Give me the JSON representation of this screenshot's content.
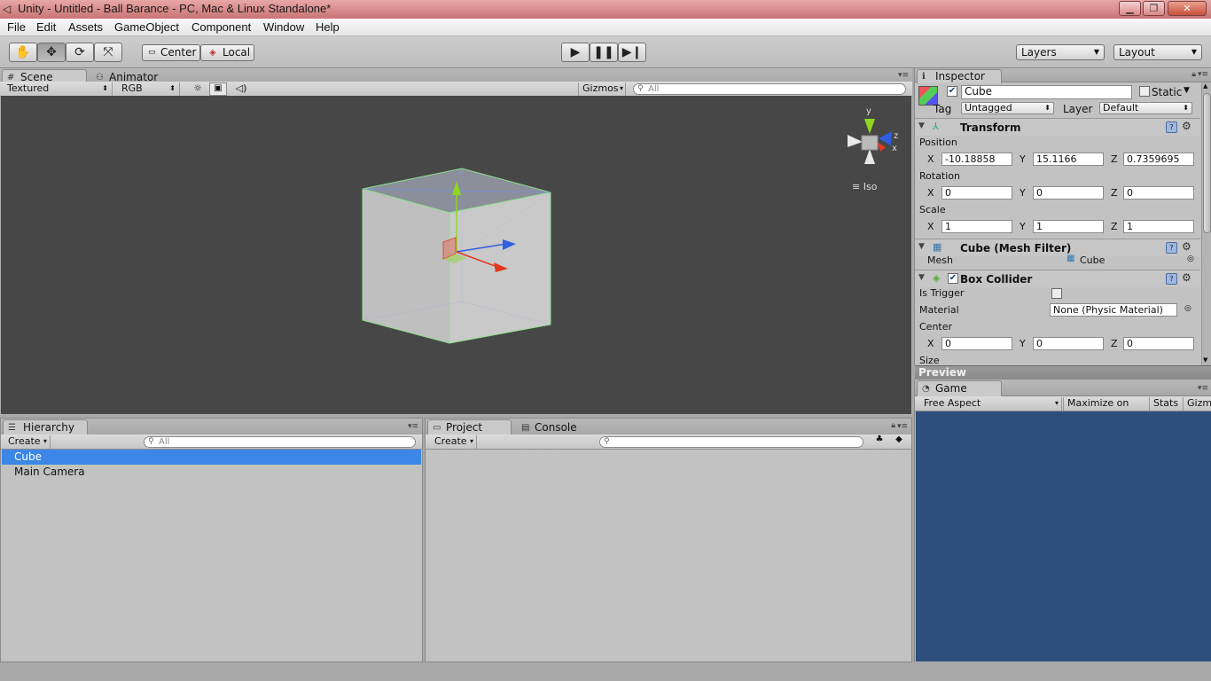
{
  "window": {
    "title": "Unity - Untitled - Ball Barance - PC, Mac & Linux Standalone*"
  },
  "menu": [
    "File",
    "Edit",
    "Assets",
    "GameObject",
    "Component",
    "Window",
    "Help"
  ],
  "toolbar": {
    "pivot": "Center",
    "space": "Local",
    "layers": "Layers",
    "layout": "Layout"
  },
  "scene": {
    "tab_scene": "Scene",
    "tab_animator": "Animator",
    "render_mode": "Textured",
    "color_mode": "RGB",
    "gizmos": "Gizmos",
    "search_placeholder": "All",
    "iso_label": "Iso",
    "gizmo_axes": {
      "y": "y",
      "z": "z",
      "x": "x"
    }
  },
  "hierarchy": {
    "tab": "Hierarchy",
    "create": "Create",
    "search_placeholder": "All",
    "items": [
      "Cube",
      "Main Camera"
    ],
    "selected_index": 0
  },
  "project": {
    "tab_project": "Project",
    "tab_console": "Console",
    "create": "Create"
  },
  "inspector": {
    "tab": "Inspector",
    "object_name": "Cube",
    "static_label": "Static",
    "tag_label": "Tag",
    "tag_value": "Untagged",
    "layer_label": "Layer",
    "layer_value": "Default",
    "transform": {
      "title": "Transform",
      "position_label": "Position",
      "rotation_label": "Rotation",
      "scale_label": "Scale",
      "axis_x": "X",
      "axis_y": "Y",
      "axis_z": "Z",
      "position": {
        "x": "-10.18858",
        "y": "15.1166",
        "z": "0.7359695"
      },
      "rotation": {
        "x": "0",
        "y": "0",
        "z": "0"
      },
      "scale": {
        "x": "1",
        "y": "1",
        "z": "1"
      }
    },
    "mesh_filter": {
      "title": "Cube (Mesh Filter)",
      "mesh_label": "Mesh",
      "mesh_value": "Cube"
    },
    "box_collider": {
      "title": "Box Collider",
      "is_trigger_label": "Is Trigger",
      "material_label": "Material",
      "material_value": "None (Physic Material)",
      "center_label": "Center",
      "center": {
        "x": "0",
        "y": "0",
        "z": "0"
      },
      "size_label": "Size"
    },
    "preview": "Preview"
  },
  "game": {
    "tab": "Game",
    "aspect": "Free Aspect",
    "maximize": "Maximize on Play",
    "stats": "Stats",
    "gizmos": "Gizmos",
    "background_color": "#2e4f7e"
  },
  "colors": {
    "selection": "#3b86e6",
    "viewport": "#474747",
    "axis_x": "#e0391f",
    "axis_y": "#8fd61f",
    "axis_z": "#2f5ee0"
  }
}
